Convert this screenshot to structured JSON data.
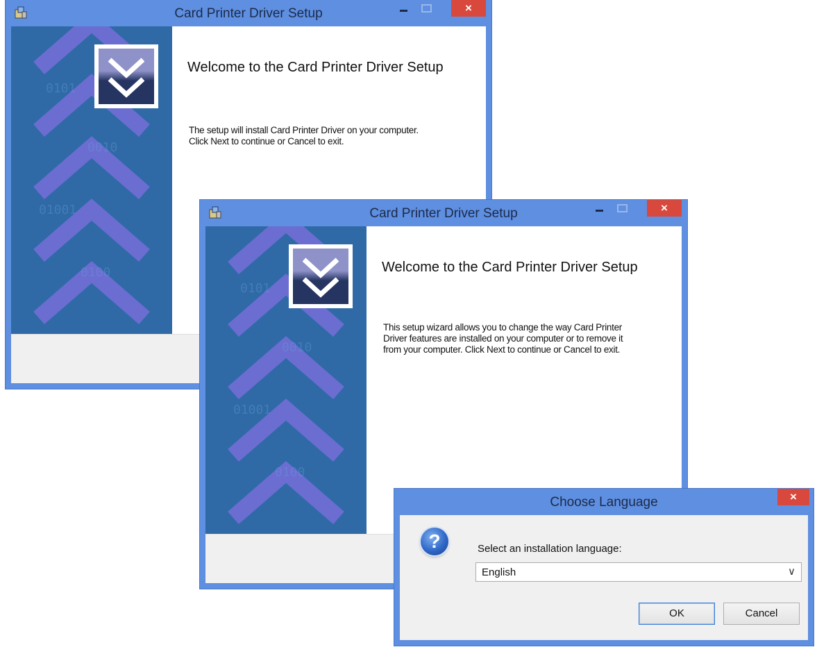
{
  "window1": {
    "title": "Card Printer Driver Setup",
    "heading": "Welcome to the Card Printer Driver Setup",
    "body_line1": "The setup will install Card Printer Driver on your computer.",
    "body_line2": "Click Next to continue or Cancel to exit.",
    "controls": {
      "minimize": "minimize-icon",
      "maximize": "maximize-icon",
      "close": "close-icon",
      "close_glyph": "×"
    }
  },
  "window2": {
    "title": "Card Printer Driver Setup",
    "heading": "Welcome to the Card Printer Driver Setup",
    "body_line1": "This setup wizard allows you to change the way Card Printer",
    "body_line2": "Driver features are installed on your computer or to remove it",
    "body_line3": "from your computer. Click Next to continue or Cancel to exit.",
    "close_glyph": "×"
  },
  "language_dialog": {
    "title": "Choose Language",
    "close_glyph": "×",
    "icon": "question-icon",
    "icon_glyph": "?",
    "prompt": "Select an installation language:",
    "selected_language": "English",
    "dropdown_glyph": "∨",
    "ok_label": "OK",
    "cancel_label": "Cancel"
  },
  "colors": {
    "window_frame": "#5e8fe0",
    "close_button": "#d9483c",
    "banner": "#2f6aa6",
    "chevrons": "#7f6fe0"
  }
}
